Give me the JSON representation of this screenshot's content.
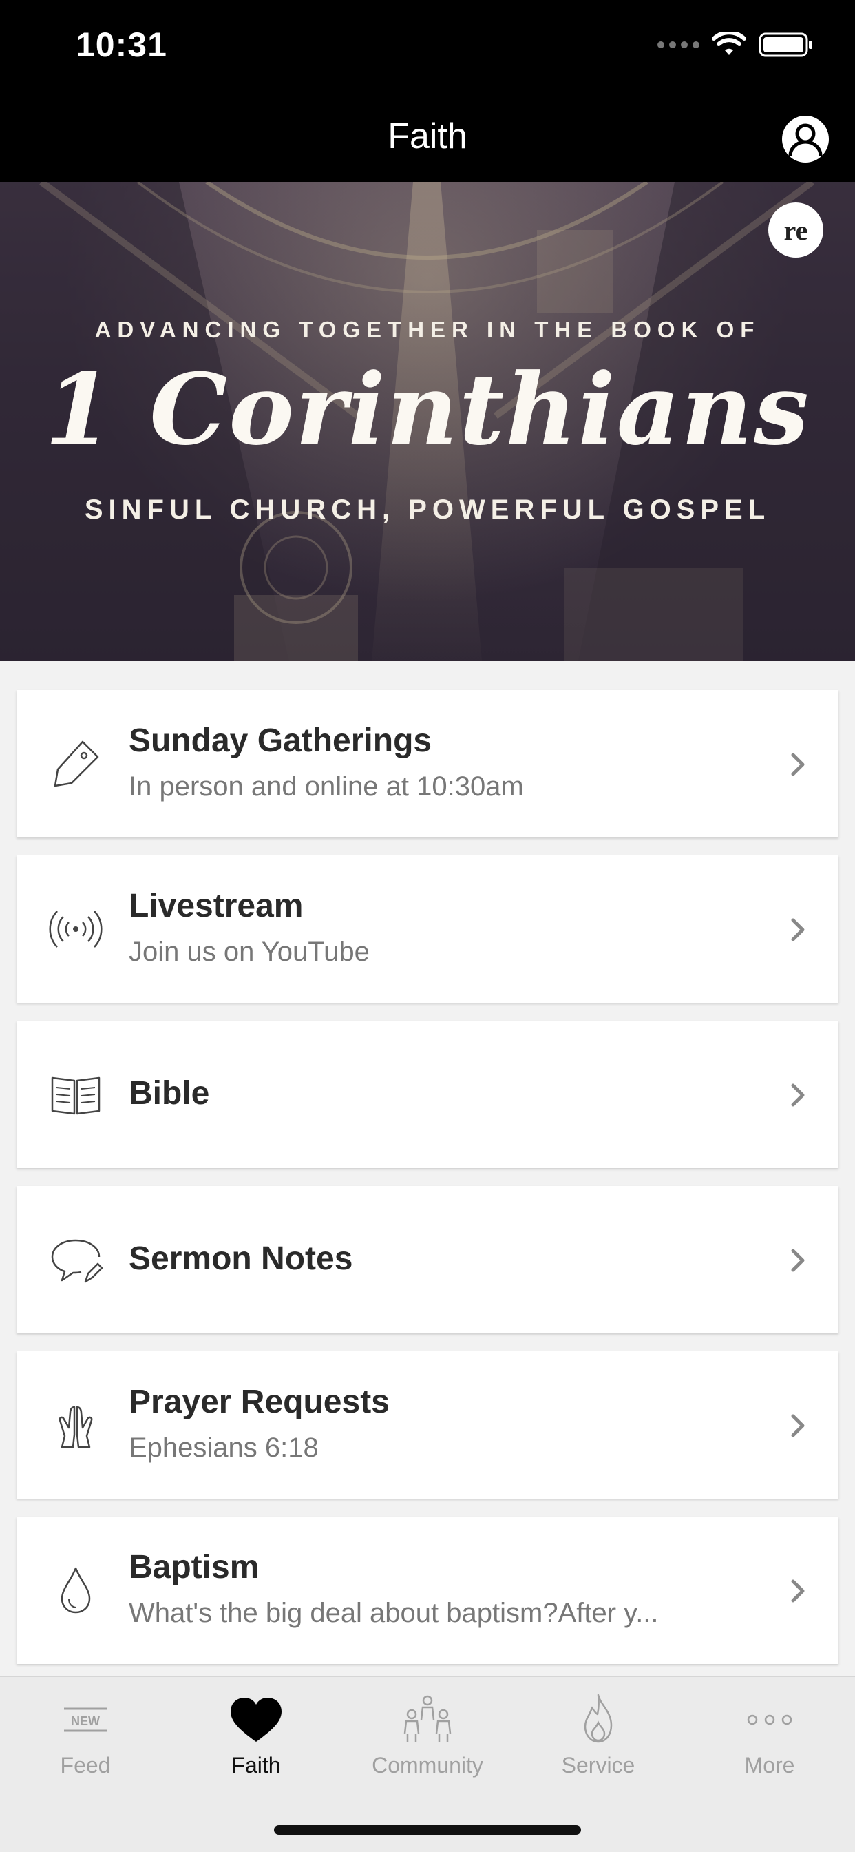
{
  "status_bar": {
    "time": "10:31"
  },
  "nav": {
    "title": "Faith"
  },
  "hero": {
    "kicker": "ADVANCING TOGETHER IN THE BOOK OF",
    "title": "1 Corinthians",
    "subtitle": "SINFUL CHURCH, POWERFUL GOSPEL",
    "badge": "re"
  },
  "cards": [
    {
      "title": "Sunday Gatherings",
      "subtitle": "In person and online at 10:30am",
      "icon": "tag-icon"
    },
    {
      "title": "Livestream",
      "subtitle": "Join us on YouTube",
      "icon": "broadcast-icon"
    },
    {
      "title": "Bible",
      "subtitle": "",
      "icon": "open-book-icon"
    },
    {
      "title": "Sermon Notes",
      "subtitle": "",
      "icon": "speech-bubble-pencil-icon"
    },
    {
      "title": "Prayer Requests",
      "subtitle": "Ephesians 6:18",
      "icon": "praying-hands-icon"
    },
    {
      "title": "Baptism",
      "subtitle": "What's the big deal about baptism?After y...",
      "icon": "water-drop-icon"
    }
  ],
  "tabs": [
    {
      "label": "Feed",
      "icon": "new-badge-icon",
      "icon_text": "NEW",
      "active": false
    },
    {
      "label": "Faith",
      "icon": "heart-icon",
      "active": true
    },
    {
      "label": "Community",
      "icon": "people-icon",
      "active": false
    },
    {
      "label": "Service",
      "icon": "flame-icon",
      "active": false
    },
    {
      "label": "More",
      "icon": "more-dots-icon",
      "active": false
    }
  ],
  "colors": {
    "bar_background": "#000000",
    "card_background": "#ffffff",
    "tab_inactive": "#a0a0a0",
    "tab_active": "#111111"
  }
}
